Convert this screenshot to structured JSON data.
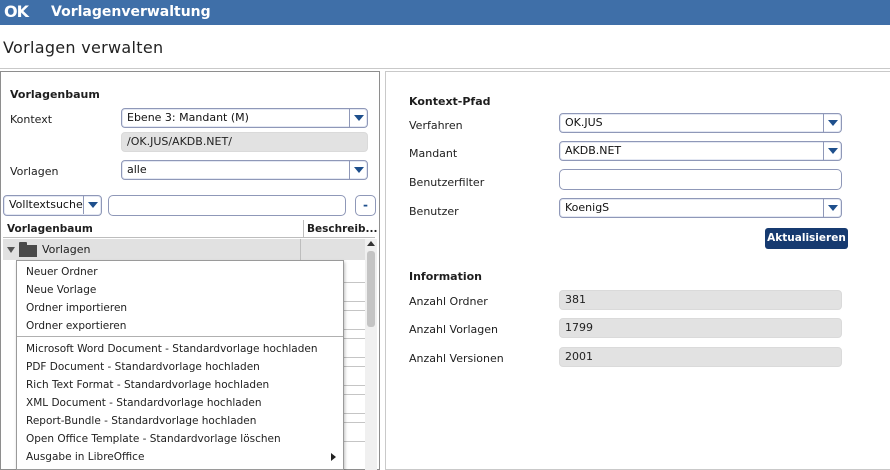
{
  "app": {
    "logo": "OK",
    "title": "Vorlagenverwaltung"
  },
  "page": {
    "title": "Vorlagen verwalten"
  },
  "left": {
    "section_title": "Vorlagenbaum",
    "kontext_label": "Kontext",
    "kontext_value": "Ebene 3: Mandant (M)",
    "kontext_path": "/OK.JUS/AKDB.NET/",
    "vorlagen_label": "Vorlagen",
    "vorlagen_value": "alle",
    "search_type": "Volltextsuche",
    "search_value": "",
    "collapse_label": "-",
    "tree_header": {
      "col1": "Vorlagenbaum",
      "col2": "Beschreib..."
    },
    "tree_root": "Vorlagen"
  },
  "context_menu": {
    "items": [
      "Neuer Ordner",
      "Neue Vorlage",
      "Ordner importieren",
      "Ordner exportieren",
      "Microsoft Word Document - Standardvorlage hochladen",
      "PDF Document - Standardvorlage hochladen",
      "Rich Text Format - Standardvorlage hochladen",
      "XML Document - Standardvorlage hochladen",
      "Report-Bundle - Standardvorlage hochladen",
      "Open Office Template - Standardvorlage löschen",
      "Ausgabe in LibreOffice"
    ]
  },
  "right": {
    "section_title": "Kontext-Pfad",
    "verfahren_label": "Verfahren",
    "verfahren_value": "OK.JUS",
    "mandant_label": "Mandant",
    "mandant_value": "AKDB.NET",
    "benutzerfilter_label": "Benutzerfilter",
    "benutzerfilter_value": "",
    "benutzer_label": "Benutzer",
    "benutzer_value": "KoenigS",
    "refresh_label": "Aktualisieren",
    "info_title": "Information",
    "anzahl_ordner_label": "Anzahl Ordner",
    "anzahl_ordner_value": "381",
    "anzahl_vorlagen_label": "Anzahl Vorlagen",
    "anzahl_vorlagen_value": "1799",
    "anzahl_versionen_label": "Anzahl Versionen",
    "anzahl_versionen_value": "2001"
  },
  "colors": {
    "titlebar": "#3f6fa8",
    "button": "#163a70",
    "accent": "#1e4f8c"
  }
}
